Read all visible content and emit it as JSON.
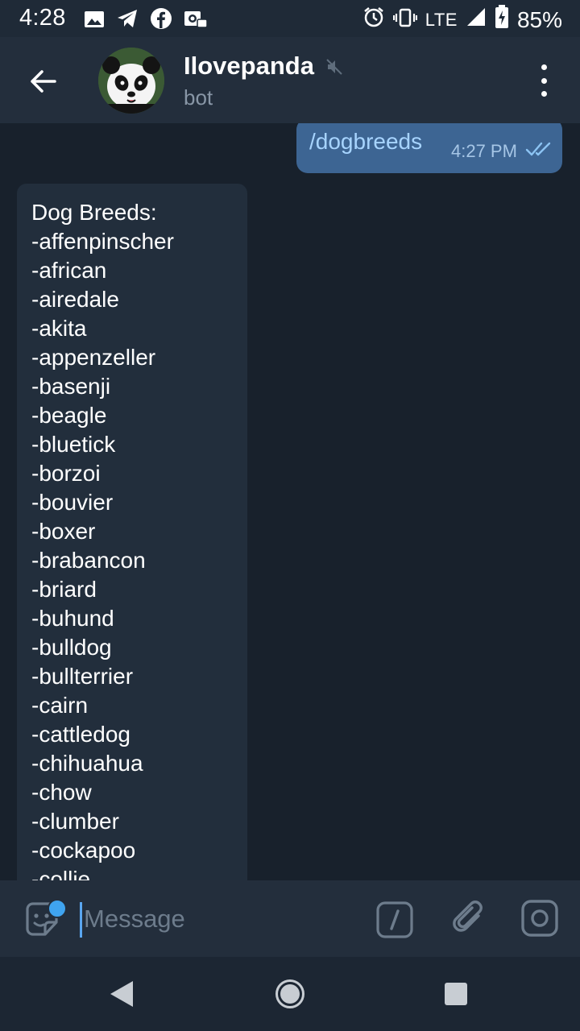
{
  "status_bar": {
    "time": "4:28",
    "network": "LTE",
    "battery": "85%",
    "left_icons": [
      "image-icon",
      "telegram-icon",
      "facebook-icon",
      "vpn-icon"
    ],
    "right_icons": [
      "alarm-icon",
      "vibrate-icon",
      "signal-icon",
      "battery-charging-icon"
    ]
  },
  "header": {
    "title": "Ilovepanda",
    "subtitle": "bot",
    "muted": true
  },
  "messages": {
    "outgoing": {
      "text": "/dogbreeds",
      "time": "4:27 PM",
      "status": "read"
    },
    "incoming": {
      "lines": [
        "Dog Breeds:",
        "-affenpinscher",
        "-african",
        "-airedale",
        "-akita",
        "-appenzeller",
        "-basenji",
        "-beagle",
        "-bluetick",
        "-borzoi",
        "-bouvier",
        "-boxer",
        "-brabancon",
        "-briard",
        "-buhund",
        "-bulldog",
        "-bullterrier",
        "-cairn",
        "-cattledog",
        "-chihuahua",
        "-chow",
        "-clumber",
        "-cockapoo",
        "-collie"
      ]
    }
  },
  "composer": {
    "placeholder": "Message",
    "value": ""
  },
  "colors": {
    "background": "#18212c",
    "header": "#232e3c",
    "outgoing_bubble": "#3d6593",
    "incoming_bubble": "#222e3c",
    "accent": "#5aa6f0"
  }
}
